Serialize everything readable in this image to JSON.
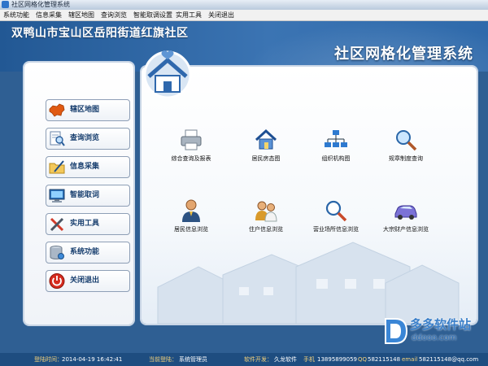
{
  "window": {
    "title": "社区网格化管理系统"
  },
  "menu": [
    "系统功能",
    "信息采集",
    "辖区地图",
    "查询浏览",
    "智能取调设置",
    "实用工具",
    "关闭退出"
  ],
  "header": {
    "community": "双鸭山市宝山区岳阳街道红旗社区",
    "system_name": "社区网格化管理系统"
  },
  "nav": [
    {
      "label": "辖区地图",
      "icon": "china-map-icon"
    },
    {
      "label": "查询浏览",
      "icon": "magnifier-document-icon"
    },
    {
      "label": "信息采集",
      "icon": "folder-pen-icon"
    },
    {
      "label": "智能取词",
      "icon": "monitor-icon"
    },
    {
      "label": "实用工具",
      "icon": "tools-icon"
    },
    {
      "label": "系统功能",
      "icon": "database-icon"
    },
    {
      "label": "关闭退出",
      "icon": "power-icon"
    }
  ],
  "tiles": [
    {
      "label": "综合查询及报表",
      "icon": "printer-icon"
    },
    {
      "label": "居民房态图",
      "icon": "house-icon"
    },
    {
      "label": "组织机构图",
      "icon": "org-chart-icon"
    },
    {
      "label": "规章制度查询",
      "icon": "search-icon"
    },
    {
      "label": "居民信息浏览",
      "icon": "person-icon"
    },
    {
      "label": "住户信息浏览",
      "icon": "family-icon"
    },
    {
      "label": "营业场所信息浏览",
      "icon": "shop-search-icon"
    },
    {
      "label": "大宗财产信息浏览",
      "icon": "car-icon"
    }
  ],
  "status": {
    "login_time_label": "登陆时间：",
    "login_time": "2014-04-19 16:42:41",
    "current_user_label": "当前登陆：",
    "current_user": "系统管理员",
    "developer_label": "软件开发：",
    "developer": "久龙软件",
    "phone_label": "手机",
    "phone": "13895899059",
    "qq_label": "QQ",
    "qq": "582115148",
    "email_label": "email",
    "email": "582115148@qq.com"
  },
  "watermark": {
    "name": "多多软件站",
    "url": "ddooo.com"
  },
  "colors": {
    "header": "#2f6aab",
    "status_bar": "#1e4d80",
    "nav_text": "#173e6e",
    "status_label": "#f6d37a"
  }
}
